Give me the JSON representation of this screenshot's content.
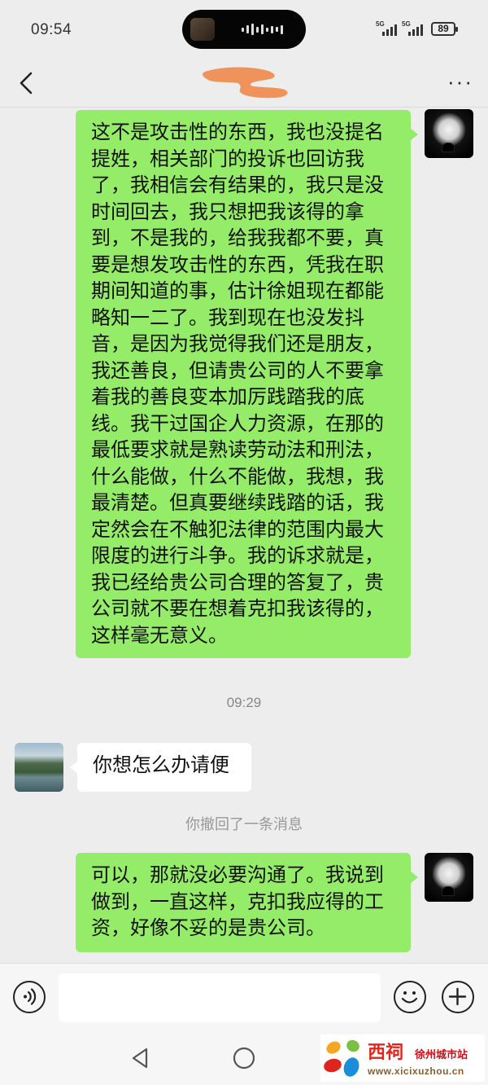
{
  "status_bar": {
    "time": "09:54",
    "signal_1": "5G",
    "signal_2": "5G",
    "battery": "89"
  },
  "nav": {
    "back_icon": "chevron-left-icon",
    "title": "",
    "more_icon": "more-dots-icon",
    "more_label": "···"
  },
  "messages": [
    {
      "direction": "sent",
      "text": "这不是攻击性的东西，我也没提名提姓，相关部门的投诉也回访我了，我相信会有结果的，我只是没时间回去，我只想把我该得的拿到，不是我的，给我我都不要，真要是想发攻击性的东西，凭我在职期间知道的事，估计徐姐现在都能略知一二了。我到现在也没发抖音，是因为我觉得我们还是朋友，我还善良，但请贵公司的人不要拿着我的善良变本加厉践踏我的底线。我干过国企人力资源，在那的最低要求就是熟读劳动法和刑法，什么能做，什么不能做，我想，我最清楚。但真要继续践踏的话，我定然会在不触犯法律的范围内最大限度的进行斗争。我的诉求就是，我已经给贵公司合理的答复了，贵公司就不要在想着克扣我该得的，这样毫无意义。"
    },
    {
      "direction": "received",
      "text": "你想怎么办请便"
    },
    {
      "direction": "sent",
      "text": "可以，那就没必要沟通了。我说到做到，一直这样，克扣我应得的工资，好像不妥的是贵公司。"
    }
  ],
  "timestamp": "09:29",
  "system_note": "你撤回了一条消息",
  "input_bar": {
    "voice_icon": "voice-icon",
    "emoji_icon": "emoji-icon",
    "plus_icon": "plus-icon",
    "input_value": ""
  },
  "system_nav": {
    "back_icon": "triangle-back-icon",
    "home_icon": "circle-home-icon"
  },
  "watermark": {
    "brand": "西祠",
    "city": "徐州城市站",
    "url": "www.xicixuzhou.cn"
  },
  "colors": {
    "background": "#ededed",
    "sent_bubble": "#95ec69",
    "received_bubble": "#ffffff",
    "redaction": "#f0935a"
  }
}
